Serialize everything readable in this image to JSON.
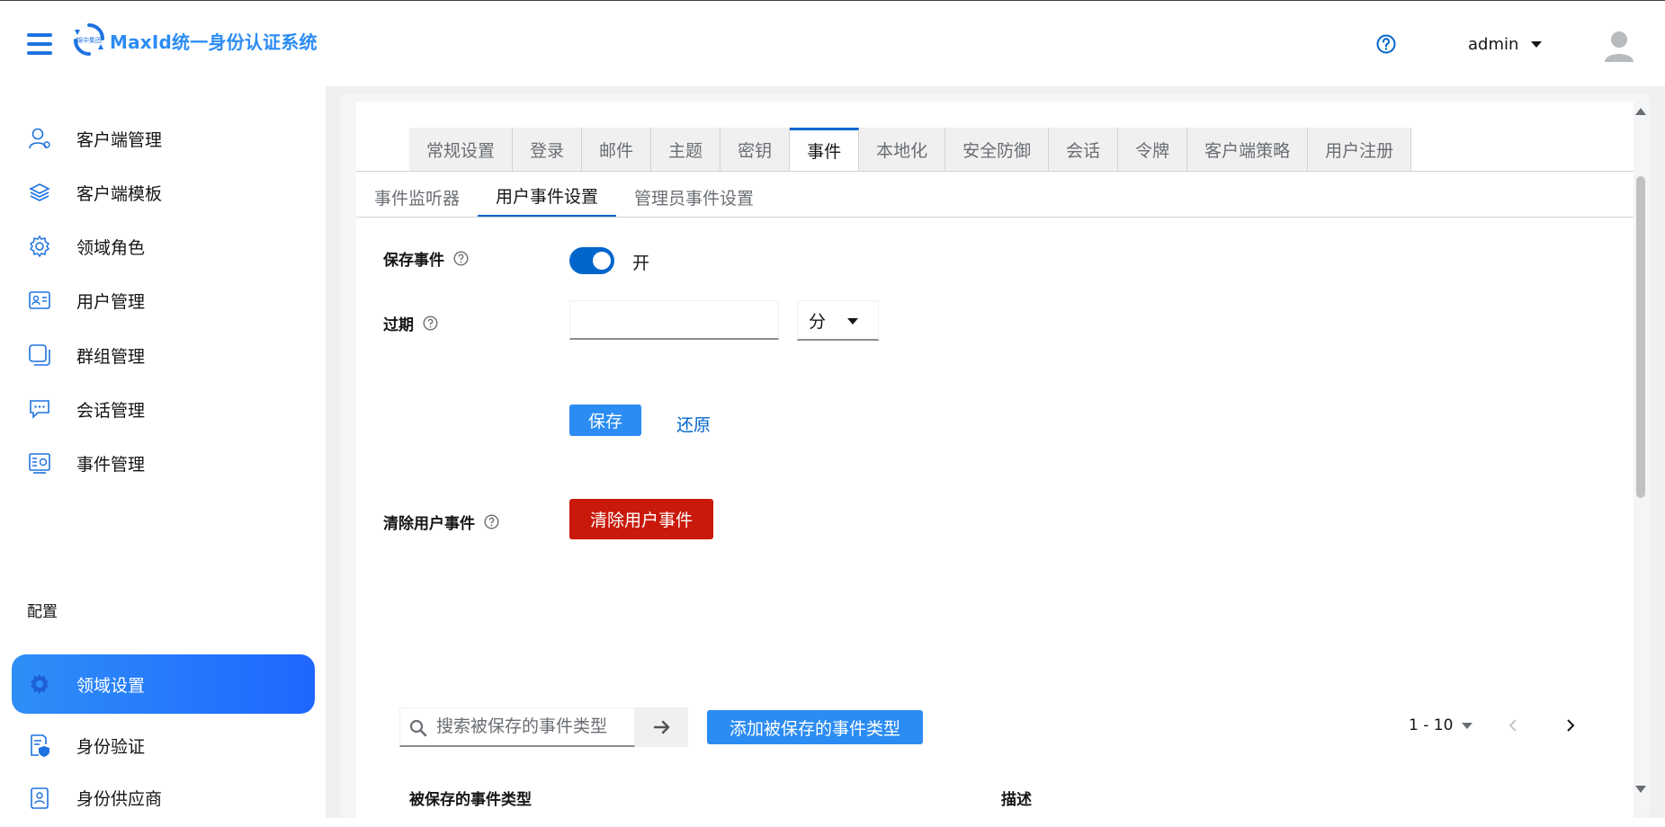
{
  "app": {
    "brand": "MaxId统一身份认证系统",
    "logo_text": "锦中集团",
    "user_name": "admin"
  },
  "sidebar": {
    "items": [
      {
        "label": "客户端管理",
        "icon": "user-icon"
      },
      {
        "label": "客户端模板",
        "icon": "layers-icon"
      },
      {
        "label": "领域角色",
        "icon": "gear-icon"
      },
      {
        "label": "用户管理",
        "icon": "id-card-icon"
      },
      {
        "label": "群组管理",
        "icon": "group-icon"
      },
      {
        "label": "会话管理",
        "icon": "chat-icon"
      },
      {
        "label": "事件管理",
        "icon": "event-icon"
      }
    ],
    "section": "配置",
    "config_items": [
      {
        "label": "领域设置",
        "icon": "gear-icon",
        "active": true
      },
      {
        "label": "身份验证",
        "icon": "shield-doc-icon"
      },
      {
        "label": "身份供应商",
        "icon": "id-badge-icon"
      }
    ]
  },
  "tabs": [
    "常规设置",
    "登录",
    "邮件",
    "主题",
    "密钥",
    "事件",
    "本地化",
    "安全防御",
    "会话",
    "令牌",
    "客户端策略",
    "用户注册"
  ],
  "active_tab": "事件",
  "subtabs": [
    "事件监听器",
    "用户事件设置",
    "管理员事件设置"
  ],
  "active_subtab": "用户事件设置",
  "form": {
    "save_events_label": "保存事件",
    "save_events_state": "开",
    "save_events_on": true,
    "expiration_label": "过期",
    "expiration_value": "",
    "expiration_unit": "分",
    "save_button": "保存",
    "revert_link": "还原",
    "clear_label": "清除用户事件",
    "clear_button": "清除用户事件"
  },
  "toolbar": {
    "search_placeholder": "搜索被保存的事件类型",
    "add_button": "添加被保存的事件类型",
    "pager_range": "1 - 10"
  },
  "table": {
    "columns": [
      "被保存的事件类型",
      "描述"
    ]
  },
  "colors": {
    "accent": "#0066cc",
    "brand": "#2c8cf4",
    "danger": "#c9190b",
    "button": "#2b8cf3"
  }
}
